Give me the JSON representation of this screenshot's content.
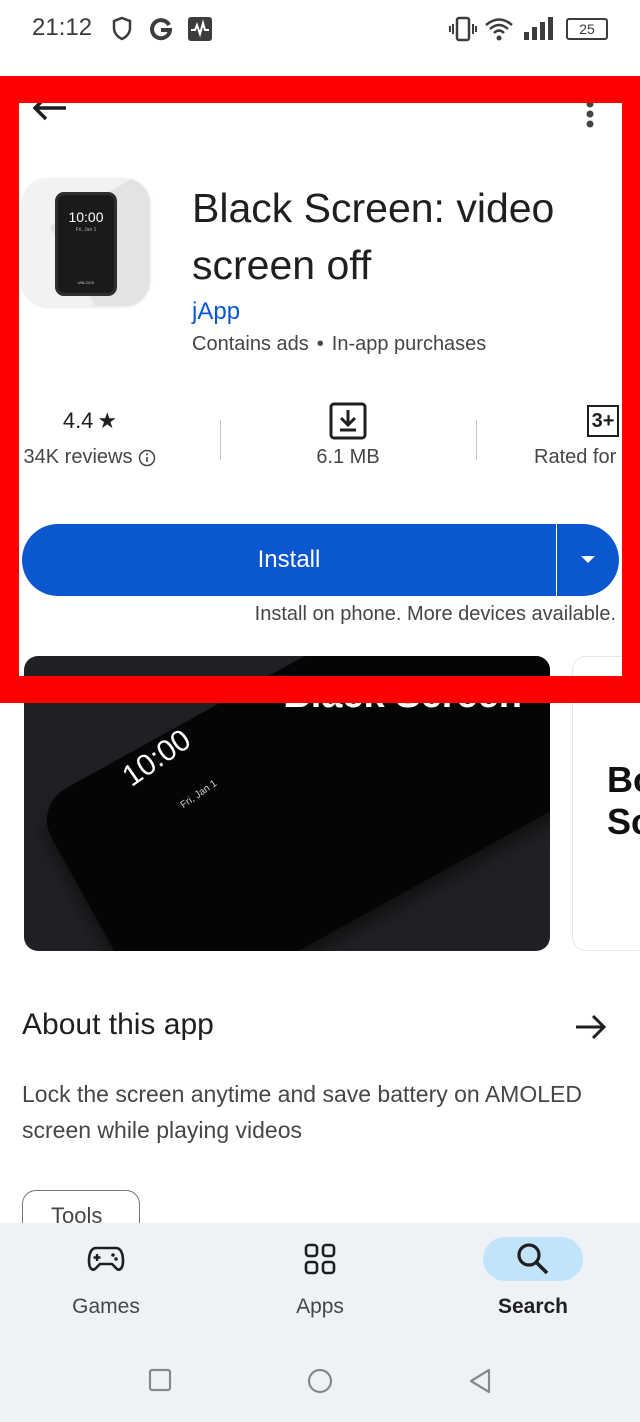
{
  "status_bar": {
    "time": "21:12",
    "battery": "25",
    "icons": [
      "shield-icon",
      "google-icon",
      "activity-icon",
      "vibrate-icon",
      "wifi-icon",
      "signal-icon",
      "battery-icon"
    ]
  },
  "top_bar": {
    "back_icon": "arrow-back-icon",
    "menu_icon": "more-vert-icon"
  },
  "app": {
    "title": "Black Screen: video screen off",
    "developer": "jApp",
    "meta_ads": "Contains ads",
    "meta_separator": "•",
    "meta_iap": "In-app purchases",
    "icon": {
      "time": "10:00",
      "date": "Fri, Jan 1",
      "unlock": "UNLOCK"
    }
  },
  "stats": {
    "rating": "4.4",
    "rating_star": "★",
    "reviews": "34K reviews",
    "size": "6.1 MB",
    "age_badge": "3+",
    "age_label": "Rated for"
  },
  "install": {
    "label": "Install",
    "note": "Install on phone. More devices available."
  },
  "screenshots": {
    "first_title": "Black Screen",
    "first_time": "10:00",
    "first_date": "Fri, Jan 1",
    "second_text": "Bo Sc"
  },
  "about": {
    "title": "About this app",
    "description": "Lock the screen anytime and save battery on AMOLED screen while playing videos",
    "tag": "Tools"
  },
  "bottom_nav": {
    "items": [
      {
        "label": "Games",
        "icon": "gamepad-icon",
        "active": false
      },
      {
        "label": "Apps",
        "icon": "apps-grid-icon",
        "active": false
      },
      {
        "label": "Search",
        "icon": "search-icon",
        "active": true
      }
    ]
  },
  "colors": {
    "accent": "#0b57d0",
    "highlight": "#ff0000",
    "nav_active_pill": "#c2e4fb",
    "nav_background": "#eef2f7"
  }
}
